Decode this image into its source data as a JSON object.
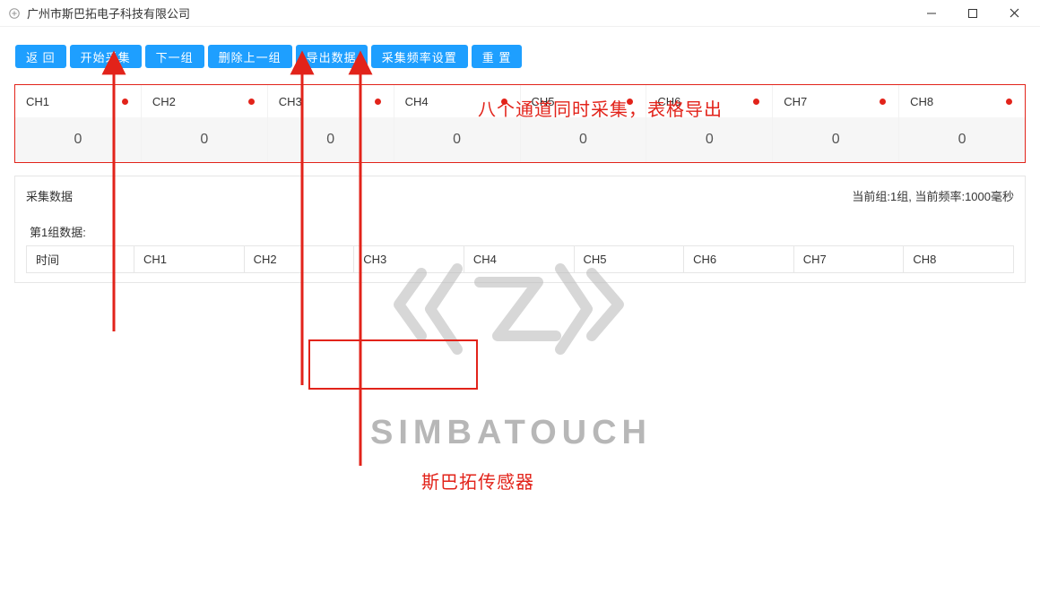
{
  "window": {
    "title": "广州市斯巴拓电子科技有限公司"
  },
  "toolbar": {
    "back": "返 回",
    "start": "开始采集",
    "next_group": "下一组",
    "delete_prev": "删除上一组",
    "export": "导出数据",
    "freq_setting": "采集频率设置",
    "reset": "重 置"
  },
  "channels": [
    {
      "label": "CH1",
      "value": "0"
    },
    {
      "label": "CH2",
      "value": "0"
    },
    {
      "label": "CH3",
      "value": "0"
    },
    {
      "label": "CH4",
      "value": "0"
    },
    {
      "label": "CH5",
      "value": "0"
    },
    {
      "label": "CH6",
      "value": "0"
    },
    {
      "label": "CH7",
      "value": "0"
    },
    {
      "label": "CH8",
      "value": "0"
    }
  ],
  "panel": {
    "title": "采集数据",
    "status": "当前组:1组, 当前频率:1000毫秒",
    "group_label": "第1组数据:",
    "columns": [
      "时间",
      "CH1",
      "CH2",
      "CH3",
      "CH4",
      "CH5",
      "CH6",
      "CH7",
      "CH8"
    ]
  },
  "watermark": {
    "brand": "SIMBATOUCH",
    "subtitle": "斯巴拓传感器"
  },
  "annotation": {
    "headline": "八个通道同时采集，表格导出"
  }
}
